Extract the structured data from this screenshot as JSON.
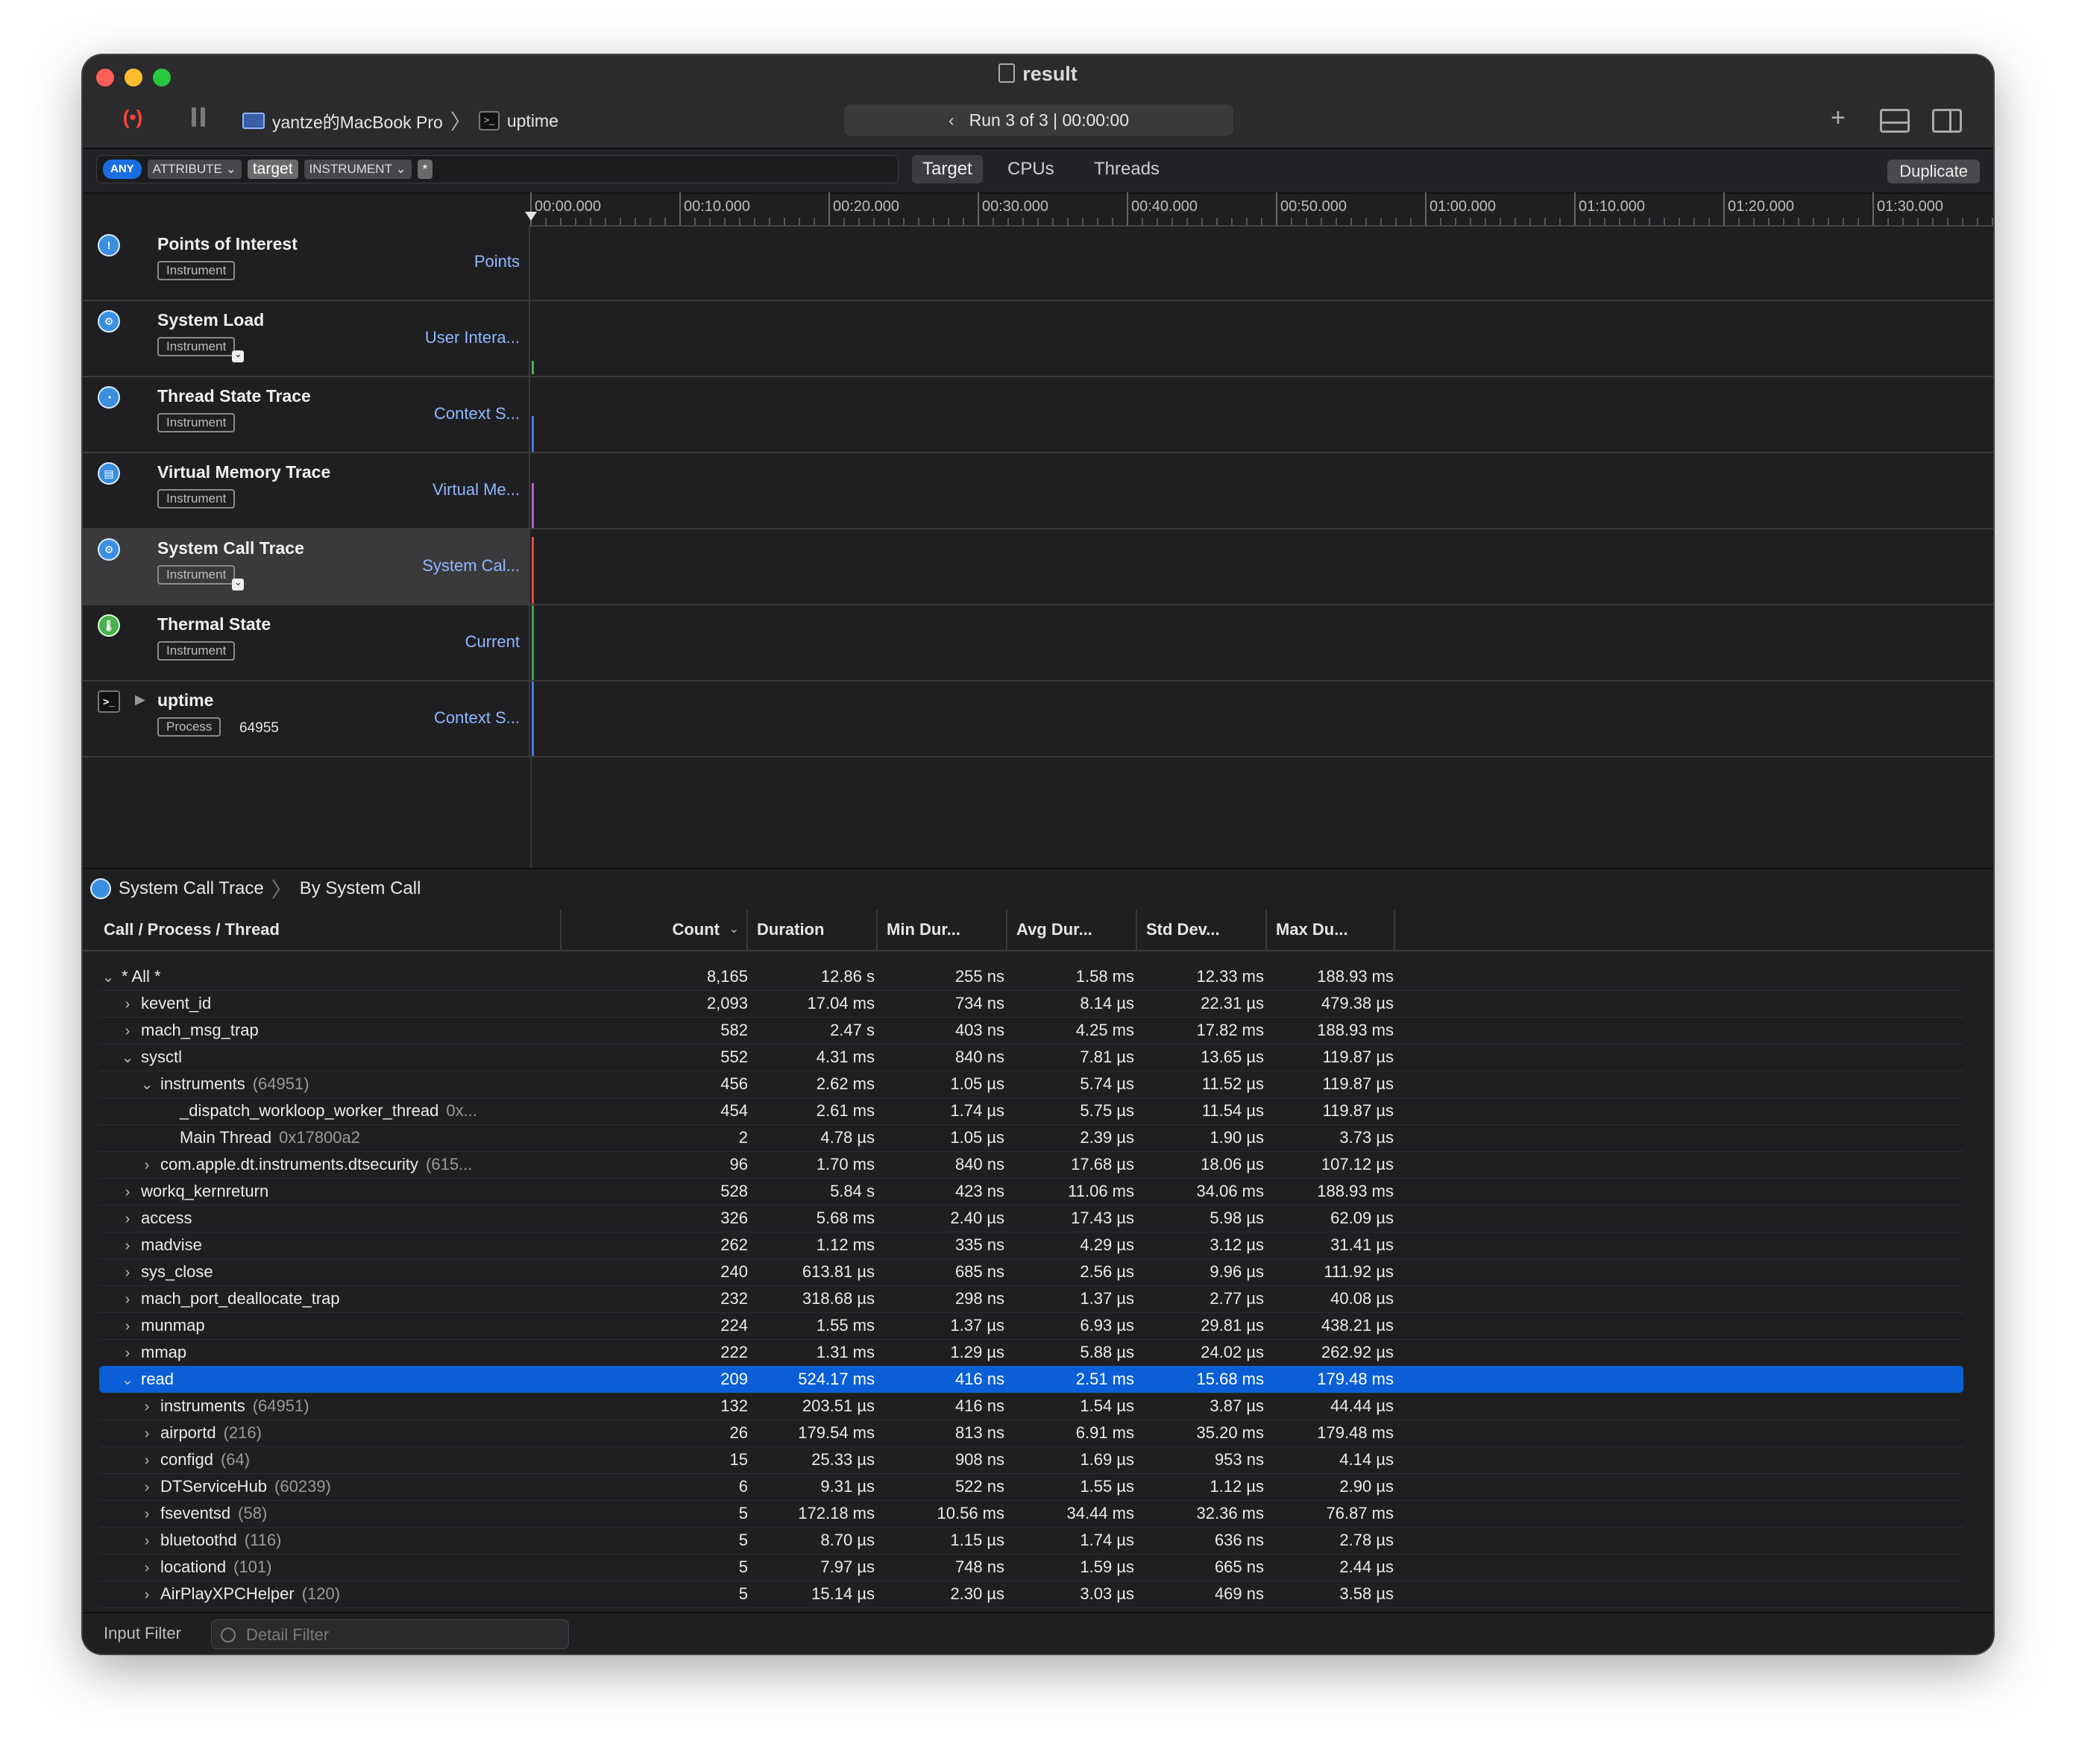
{
  "window": {
    "title": "result",
    "device": "yantze的MacBook Pro",
    "process": "uptime",
    "run_label": "Run 3 of 3",
    "run_time": "00:00:00"
  },
  "filterbar": {
    "any": "ANY",
    "attribute": "ATTRIBUTE ⌄",
    "target_token": "target",
    "instrument": "INSTRUMENT ⌄",
    "star": "*",
    "tabs": [
      "Target",
      "CPUs",
      "Threads"
    ],
    "duplicate": "Duplicate"
  },
  "ruler": [
    "00:00.000",
    "00:10.000",
    "00:20.000",
    "00:30.000",
    "00:40.000",
    "00:50.000",
    "01:00.000",
    "01:10.000",
    "01:20.000",
    "01:30.000"
  ],
  "tracks": [
    {
      "name": "Points of Interest",
      "badge": "Instrument",
      "detail": "Points"
    },
    {
      "name": "System Load",
      "badge": "Instrument",
      "detail": "User Intera..."
    },
    {
      "name": "Thread State Trace",
      "badge": "Instrument",
      "detail": "Context S..."
    },
    {
      "name": "Virtual Memory Trace",
      "badge": "Instrument",
      "detail": "Virtual Me..."
    },
    {
      "name": "System Call Trace",
      "badge": "Instrument",
      "detail": "System Cal..."
    },
    {
      "name": "Thermal State",
      "badge": "Instrument",
      "detail": "Current"
    },
    {
      "name": "uptime",
      "badge": "Process",
      "pid": "64955",
      "detail": "Context S..."
    }
  ],
  "breadcrumb": {
    "instrument": "System Call Trace",
    "view": "By System Call"
  },
  "table": {
    "headers": [
      "Call / Process / Thread",
      "Count",
      "Duration",
      "Min Dur...",
      "Avg Dur...",
      "Std Dev...",
      "Max Du..."
    ],
    "rows": [
      {
        "name": "* All *",
        "pid": "",
        "disc": "⌄",
        "count": "8,165",
        "dur": "12.86 s",
        "min": "255 ns",
        "avg": "1.58 ms",
        "std": "12.33 ms",
        "max": "188.93 ms"
      },
      {
        "name": "kevent_id",
        "pid": "",
        "disc": "›",
        "count": "2,093",
        "dur": "17.04 ms",
        "min": "734 ns",
        "avg": "8.14 µs",
        "std": "22.31 µs",
        "max": "479.38 µs"
      },
      {
        "name": "mach_msg_trap",
        "pid": "",
        "disc": "›",
        "count": "582",
        "dur": "2.47 s",
        "min": "403 ns",
        "avg": "4.25 ms",
        "std": "17.82 ms",
        "max": "188.93 ms"
      },
      {
        "name": "sysctl",
        "pid": "",
        "disc": "⌄",
        "count": "552",
        "dur": "4.31 ms",
        "min": "840 ns",
        "avg": "7.81 µs",
        "std": "13.65 µs",
        "max": "119.87 µs"
      },
      {
        "name": "instruments",
        "pid": "(64951)",
        "disc": "⌄",
        "count": "456",
        "dur": "2.62 ms",
        "min": "1.05 µs",
        "avg": "5.74 µs",
        "std": "11.52 µs",
        "max": "119.87 µs"
      },
      {
        "name": "_dispatch_workloop_worker_thread",
        "pid": "0x...",
        "disc": "",
        "count": "454",
        "dur": "2.61 ms",
        "min": "1.74 µs",
        "avg": "5.75 µs",
        "std": "11.54 µs",
        "max": "119.87 µs"
      },
      {
        "name": "Main Thread",
        "pid": "0x17800a2",
        "disc": "",
        "count": "2",
        "dur": "4.78 µs",
        "min": "1.05 µs",
        "avg": "2.39 µs",
        "std": "1.90 µs",
        "max": "3.73 µs"
      },
      {
        "name": "com.apple.dt.instruments.dtsecurity",
        "pid": "(615...",
        "disc": "›",
        "count": "96",
        "dur": "1.70 ms",
        "min": "840 ns",
        "avg": "17.68 µs",
        "std": "18.06 µs",
        "max": "107.12 µs"
      },
      {
        "name": "workq_kernreturn",
        "pid": "",
        "disc": "›",
        "count": "528",
        "dur": "5.84 s",
        "min": "423 ns",
        "avg": "11.06 ms",
        "std": "34.06 ms",
        "max": "188.93 ms"
      },
      {
        "name": "access",
        "pid": "",
        "disc": "›",
        "count": "326",
        "dur": "5.68 ms",
        "min": "2.40 µs",
        "avg": "17.43 µs",
        "std": "5.98 µs",
        "max": "62.09 µs"
      },
      {
        "name": "madvise",
        "pid": "",
        "disc": "›",
        "count": "262",
        "dur": "1.12 ms",
        "min": "335 ns",
        "avg": "4.29 µs",
        "std": "3.12 µs",
        "max": "31.41 µs"
      },
      {
        "name": "sys_close",
        "pid": "",
        "disc": "›",
        "count": "240",
        "dur": "613.81 µs",
        "min": "685 ns",
        "avg": "2.56 µs",
        "std": "9.96 µs",
        "max": "111.92 µs"
      },
      {
        "name": "mach_port_deallocate_trap",
        "pid": "",
        "disc": "›",
        "count": "232",
        "dur": "318.68 µs",
        "min": "298 ns",
        "avg": "1.37 µs",
        "std": "2.77 µs",
        "max": "40.08 µs"
      },
      {
        "name": "munmap",
        "pid": "",
        "disc": "›",
        "count": "224",
        "dur": "1.55 ms",
        "min": "1.37 µs",
        "avg": "6.93 µs",
        "std": "29.81 µs",
        "max": "438.21 µs"
      },
      {
        "name": "mmap",
        "pid": "",
        "disc": "›",
        "count": "222",
        "dur": "1.31 ms",
        "min": "1.29 µs",
        "avg": "5.88 µs",
        "std": "24.02 µs",
        "max": "262.92 µs"
      },
      {
        "name": "read",
        "pid": "",
        "disc": "⌄",
        "count": "209",
        "dur": "524.17 ms",
        "min": "416 ns",
        "avg": "2.51 ms",
        "std": "15.68 ms",
        "max": "179.48 ms"
      },
      {
        "name": "instruments",
        "pid": "(64951)",
        "disc": "›",
        "count": "132",
        "dur": "203.51 µs",
        "min": "416 ns",
        "avg": "1.54 µs",
        "std": "3.87 µs",
        "max": "44.44 µs"
      },
      {
        "name": "airportd",
        "pid": "(216)",
        "disc": "›",
        "count": "26",
        "dur": "179.54 ms",
        "min": "813 ns",
        "avg": "6.91 ms",
        "std": "35.20 ms",
        "max": "179.48 ms"
      },
      {
        "name": "configd",
        "pid": "(64)",
        "disc": "›",
        "count": "15",
        "dur": "25.33 µs",
        "min": "908 ns",
        "avg": "1.69 µs",
        "std": "953 ns",
        "max": "4.14 µs"
      },
      {
        "name": "DTServiceHub",
        "pid": "(60239)",
        "disc": "›",
        "count": "6",
        "dur": "9.31 µs",
        "min": "522 ns",
        "avg": "1.55 µs",
        "std": "1.12 µs",
        "max": "2.90 µs"
      },
      {
        "name": "fseventsd",
        "pid": "(58)",
        "disc": "›",
        "count": "5",
        "dur": "172.18 ms",
        "min": "10.56 ms",
        "avg": "34.44 ms",
        "std": "32.36 ms",
        "max": "76.87 ms"
      },
      {
        "name": "bluetoothd",
        "pid": "(116)",
        "disc": "›",
        "count": "5",
        "dur": "8.70 µs",
        "min": "1.15 µs",
        "avg": "1.74 µs",
        "std": "636 ns",
        "max": "2.78 µs"
      },
      {
        "name": "locationd",
        "pid": "(101)",
        "disc": "›",
        "count": "5",
        "dur": "7.97 µs",
        "min": "748 ns",
        "avg": "1.59 µs",
        "std": "665 ns",
        "max": "2.44 µs"
      },
      {
        "name": "AirPlayXPCHelper",
        "pid": "(120)",
        "disc": "›",
        "count": "5",
        "dur": "15.14 µs",
        "min": "2.30 µs",
        "avg": "3.03 µs",
        "std": "469 ns",
        "max": "3.58 µs"
      }
    ]
  },
  "bottom": {
    "input_filter": "Input Filter",
    "detail_placeholder": "Detail Filter"
  },
  "colors": {
    "selection": "#0a5fd6",
    "record": "#ff453a",
    "accent": "#8fb8ff"
  }
}
